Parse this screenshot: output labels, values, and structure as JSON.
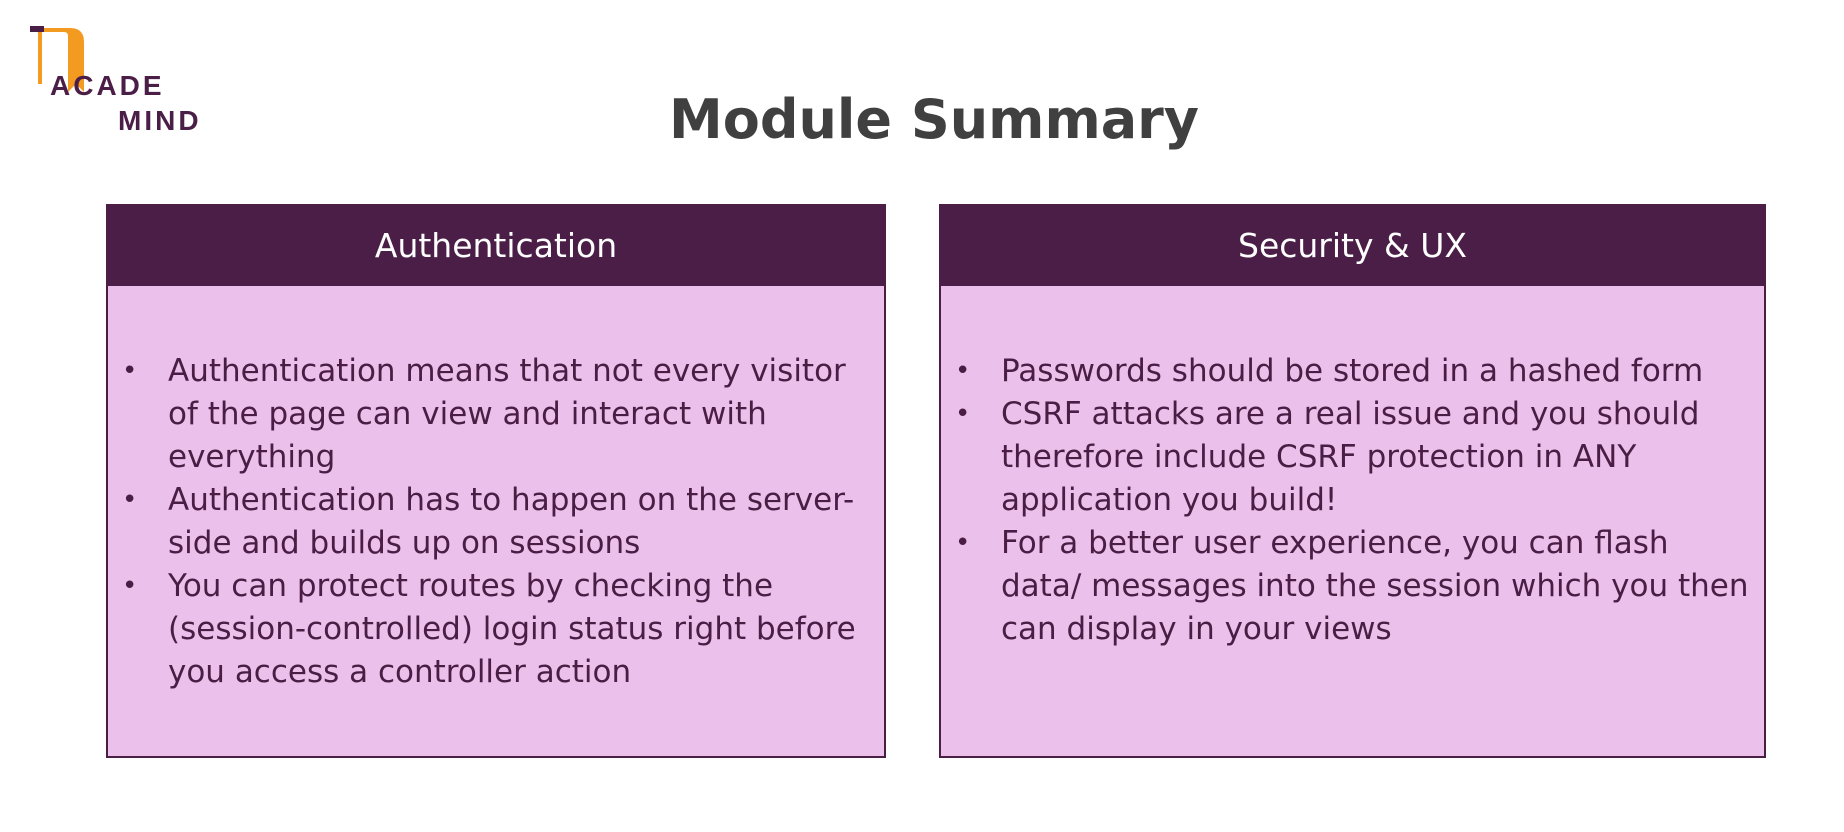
{
  "logo": {
    "line1": "ACADE",
    "line2": "MIND",
    "accent_color": "#f39a20",
    "brand_color": "#4b1e47"
  },
  "title": "Module Summary",
  "cards": [
    {
      "header": "Authentication",
      "items": [
        "Authentication means that not every visitor of the page can view and interact with everything",
        "Authentication has to happen on the server-side and builds up on sessions",
        "You can protect routes by checking the (session-controlled) login status right before you access a controller action"
      ]
    },
    {
      "header": "Security & UX",
      "items": [
        "Passwords should be stored in a hashed form",
        "CSRF attacks are a real issue and you should therefore include CSRF protection in ANY application you build!",
        "For a better user experience, you can flash data/ messages into the session which you then can display in your views"
      ]
    }
  ],
  "colors": {
    "header_bg": "#4b1e47",
    "card_bg": "#ebc0ea",
    "title_color": "#404040"
  }
}
